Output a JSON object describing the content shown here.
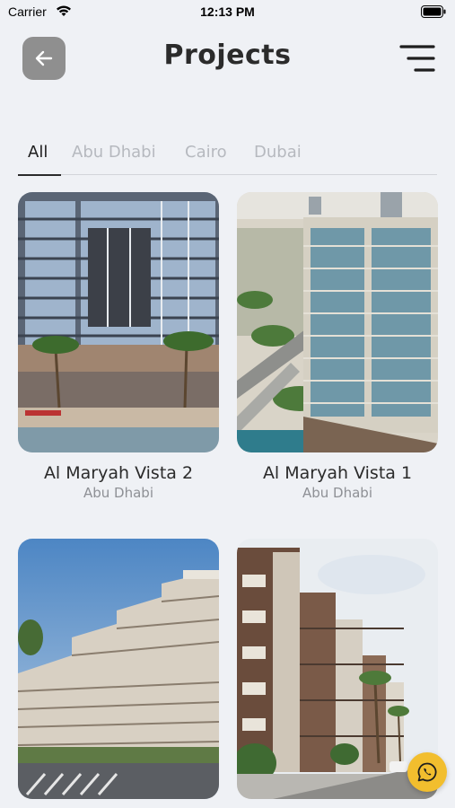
{
  "status_bar": {
    "carrier": "Carrier",
    "time": "12:13 PM"
  },
  "header": {
    "title": "Projects"
  },
  "tabs": [
    {
      "label": "All",
      "active": true
    },
    {
      "label": "Abu Dhabi",
      "active": false
    },
    {
      "label": "Cairo",
      "active": false
    },
    {
      "label": "Dubai",
      "active": false
    }
  ],
  "projects": [
    {
      "name": "Al Maryah Vista 2",
      "city": "Abu Dhabi"
    },
    {
      "name": "Al Maryah Vista 1",
      "city": "Abu Dhabi"
    },
    {
      "name": "",
      "city": ""
    },
    {
      "name": "",
      "city": ""
    }
  ],
  "icons": {
    "back": "arrow-left-icon",
    "menu": "hamburger-menu-icon",
    "chat": "whatsapp-icon"
  },
  "colors": {
    "background": "#eff1f5",
    "back_button": "#8f8f8f",
    "whatsapp_button": "#f2be2e"
  }
}
